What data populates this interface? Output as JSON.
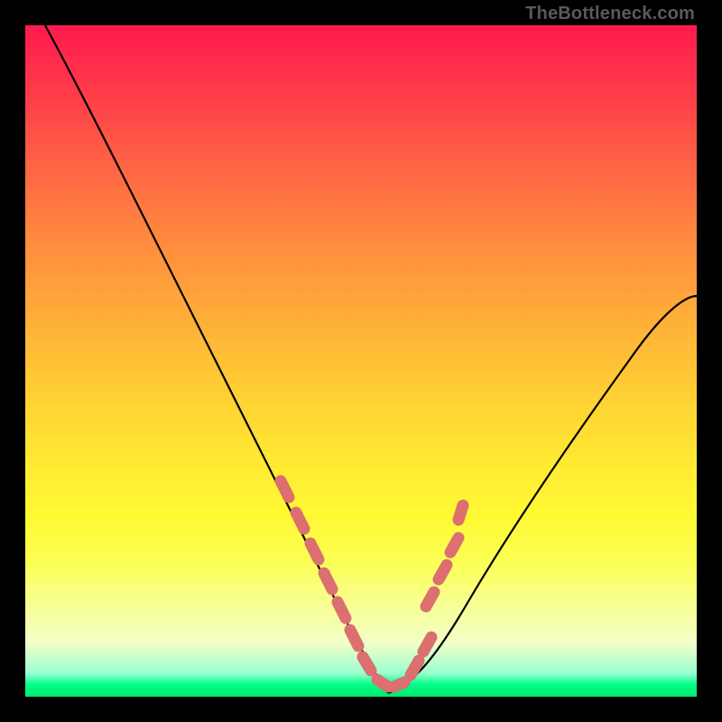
{
  "watermark": "TheBottleneck.com",
  "chart_data": {
    "type": "line",
    "title": "",
    "xlabel": "",
    "ylabel": "",
    "xlim": [
      0,
      100
    ],
    "ylim": [
      0,
      100
    ],
    "series": [
      {
        "name": "left_curve",
        "x": [
          3,
          10,
          20,
          30,
          40,
          44,
          48,
          51,
          54
        ],
        "y": [
          100,
          87,
          69,
          50,
          28,
          17,
          8,
          3,
          1
        ]
      },
      {
        "name": "right_curve",
        "x": [
          54,
          58,
          63,
          70,
          80,
          90,
          100
        ],
        "y": [
          1,
          2,
          6,
          14,
          29,
          45,
          59
        ]
      }
    ],
    "markers": {
      "name": "highlighted_points",
      "color": "#dc6f6f",
      "points": [
        {
          "x": 38,
          "y": 32
        },
        {
          "x": 41,
          "y": 24
        },
        {
          "x": 43,
          "y": 19
        },
        {
          "x": 45,
          "y": 14
        },
        {
          "x": 47,
          "y": 9
        },
        {
          "x": 49,
          "y": 5
        },
        {
          "x": 51,
          "y": 2.5
        },
        {
          "x": 53,
          "y": 1.2
        },
        {
          "x": 55,
          "y": 1.2
        },
        {
          "x": 57,
          "y": 1.8
        },
        {
          "x": 59,
          "y": 3
        },
        {
          "x": 60,
          "y": 13
        },
        {
          "x": 62,
          "y": 18
        },
        {
          "x": 64,
          "y": 24
        },
        {
          "x": 64.5,
          "y": 30
        }
      ]
    },
    "gradient_stops": [
      {
        "pos": 0,
        "color": "#ff1a4d"
      },
      {
        "pos": 50,
        "color": "#ffd233"
      },
      {
        "pos": 95,
        "color": "#f2ffc8"
      },
      {
        "pos": 100,
        "color": "#00e86e"
      }
    ]
  }
}
